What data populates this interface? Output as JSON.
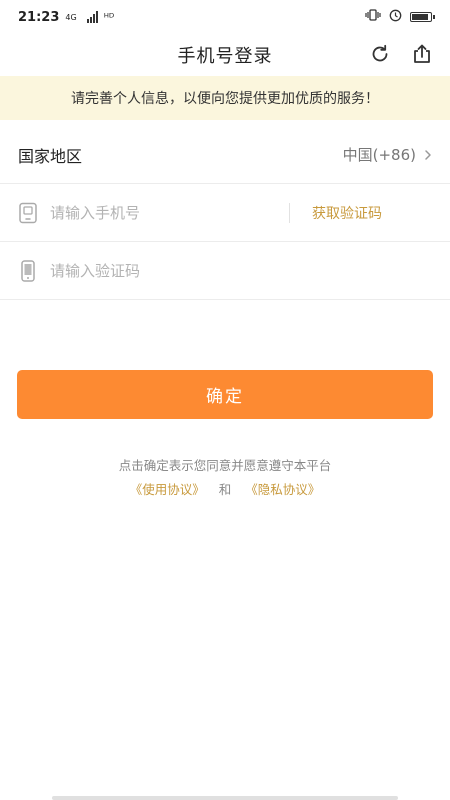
{
  "status_bar": {
    "time": "21:23",
    "network_type": "4G",
    "extra_signal": "ᴴᴰ"
  },
  "nav": {
    "title": "手机号登录",
    "refresh_icon": "refresh-icon",
    "share_icon": "share-icon"
  },
  "banner": {
    "text": "请完善个人信息，以便向您提供更加优质的服务！"
  },
  "form": {
    "region_label": "国家地区",
    "region_value": "中国(+86)",
    "phone_placeholder": "请输入手机号",
    "phone_value": "",
    "get_code_label": "获取验证码",
    "code_placeholder": "请输入验证码",
    "code_value": ""
  },
  "confirm_label": "确定",
  "agreement": {
    "text": "点击确定表示您同意并愿意遵守本平台",
    "terms_link": "《使用协议》",
    "and_text": "和",
    "privacy_link": "《隐私协议》"
  },
  "colors": {
    "accent": "#fd8a32",
    "link": "#c89a3d",
    "banner_bg": "#fbf6dd"
  }
}
